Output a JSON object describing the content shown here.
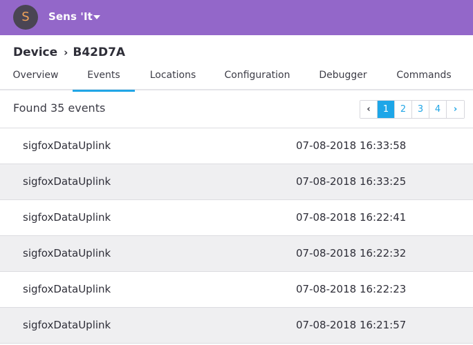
{
  "app": {
    "avatar_letter": "S",
    "name": "Sens 'It"
  },
  "breadcrumb": {
    "parent": "Device",
    "separator": "›",
    "current": "B42D7A"
  },
  "tabs": [
    {
      "label": "Overview"
    },
    {
      "label": "Events"
    },
    {
      "label": "Locations"
    },
    {
      "label": "Configuration"
    },
    {
      "label": "Debugger"
    },
    {
      "label": "Commands"
    }
  ],
  "active_tab": "Events",
  "results": {
    "summary": "Found 35 events"
  },
  "pagination": {
    "prev": "‹",
    "pages": [
      "1",
      "2",
      "3",
      "4"
    ],
    "current_page": "1",
    "next": "›"
  },
  "events": [
    {
      "name": "sigfoxDataUplink",
      "time": "07-08-2018 16:33:58"
    },
    {
      "name": "sigfoxDataUplink",
      "time": "07-08-2018 16:33:25"
    },
    {
      "name": "sigfoxDataUplink",
      "time": "07-08-2018 16:22:41"
    },
    {
      "name": "sigfoxDataUplink",
      "time": "07-08-2018 16:22:32"
    },
    {
      "name": "sigfoxDataUplink",
      "time": "07-08-2018 16:22:23"
    },
    {
      "name": "sigfoxDataUplink",
      "time": "07-08-2018 16:21:57"
    }
  ],
  "colors": {
    "header_bg": "#9367c9",
    "accent": "#1da6e8",
    "row_alt": "#efeff1"
  },
  "icons": {
    "app_menu": "chevron-down-icon"
  }
}
